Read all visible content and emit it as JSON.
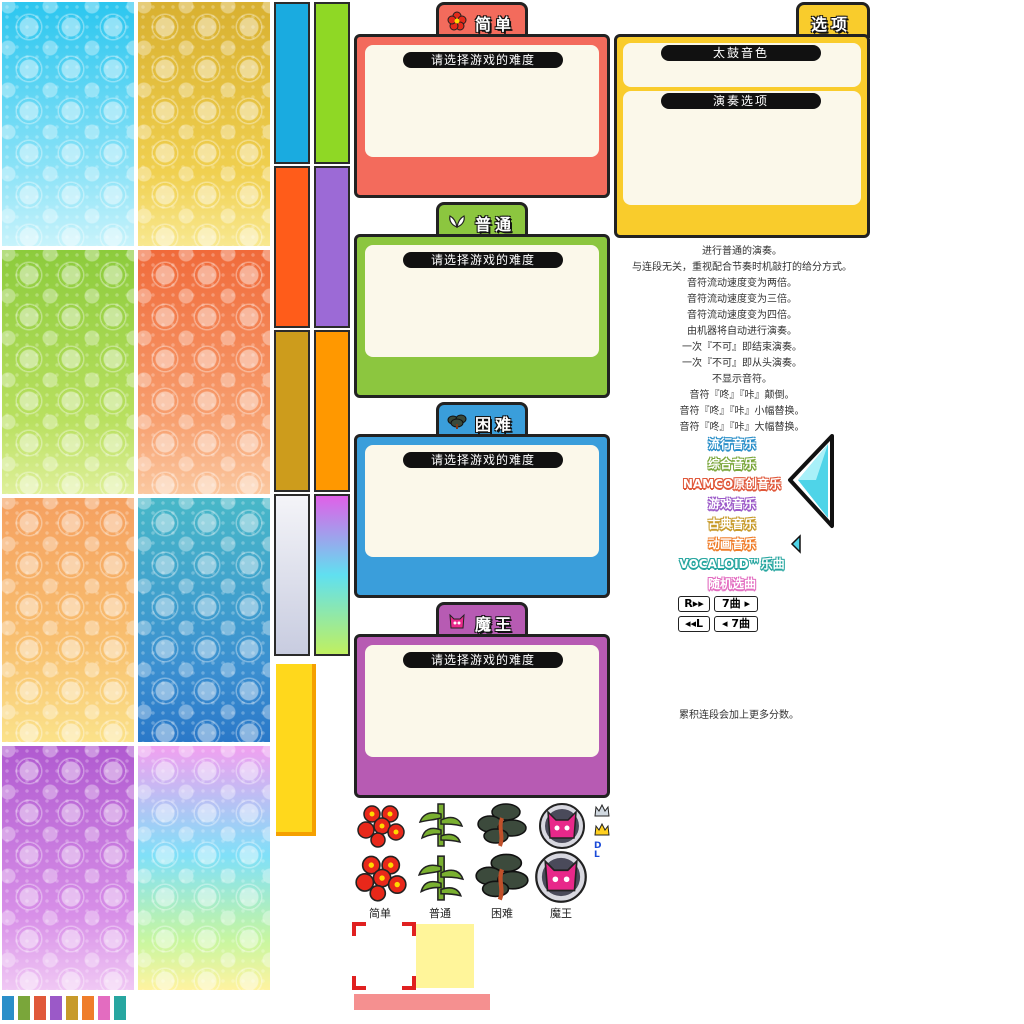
{
  "difficulties": [
    {
      "key": "easy",
      "name": "简单",
      "prompt": "请选择游戏的难度",
      "color": "#f36b5c",
      "tab_color": "#f36b5c"
    },
    {
      "key": "normal",
      "name": "普通",
      "prompt": "请选择游戏的难度",
      "color": "#8cc63f",
      "tab_color": "#8cc63f"
    },
    {
      "key": "hard",
      "name": "困难",
      "prompt": "请选择游戏的难度",
      "color": "#3a9edb",
      "tab_color": "#3a9edb"
    },
    {
      "key": "oni",
      "name": "魔王",
      "prompt": "请选择游戏的难度",
      "color": "#b75bb3",
      "tab_color": "#b75bb3"
    }
  ],
  "options": {
    "title": "选项",
    "drum_color_label": "太鼓音色",
    "play_options_label": "演奏选项"
  },
  "descriptions": [
    "进行普通的演奏。",
    "与连段无关，重视配合节奏时机敲打的给分方式。",
    "音符流动速度变为两倍。",
    "音符流动速度变为三倍。",
    "音符流动速度变为四倍。",
    "由机器将自动进行演奏。",
    "一次『不可』即结束演奏。",
    "一次『不可』即从头演奏。",
    "不显示音符。",
    "音符『咚』『咔』颠倒。",
    "音符『咚』『咔』小幅替换。",
    "音符『咚』『咔』大幅替换。"
  ],
  "combo_note": "累积连段会加上更多分数。",
  "genres": [
    {
      "label": "流行音乐",
      "color": "#2a8fc9"
    },
    {
      "label": "综合音乐",
      "color": "#7aa63a"
    },
    {
      "label": "NAMCO原创音乐",
      "color": "#e0583a"
    },
    {
      "label": "游戏音乐",
      "color": "#9b59c8"
    },
    {
      "label": "古典音乐",
      "color": "#c79a2a"
    },
    {
      "label": "动画音乐",
      "color": "#ef7d2a"
    },
    {
      "label": "VOCALOID™乐曲",
      "color": "#27a6a0"
    },
    {
      "label": "随机选曲",
      "color": "#e36cc0"
    }
  ],
  "nav": {
    "r_key": "R",
    "l_key": "L",
    "skip_next": "7曲",
    "skip_prev": "7曲"
  },
  "dl_label": "DL",
  "captions": [
    "简单",
    "普通",
    "困难",
    "魔王"
  ],
  "swatch_colors": [
    "#2a8fc9",
    "#7aa63a",
    "#e0583a",
    "#9b59c8",
    "#c79a2a",
    "#ef7d2a",
    "#e36cc0",
    "#27a6a0"
  ]
}
